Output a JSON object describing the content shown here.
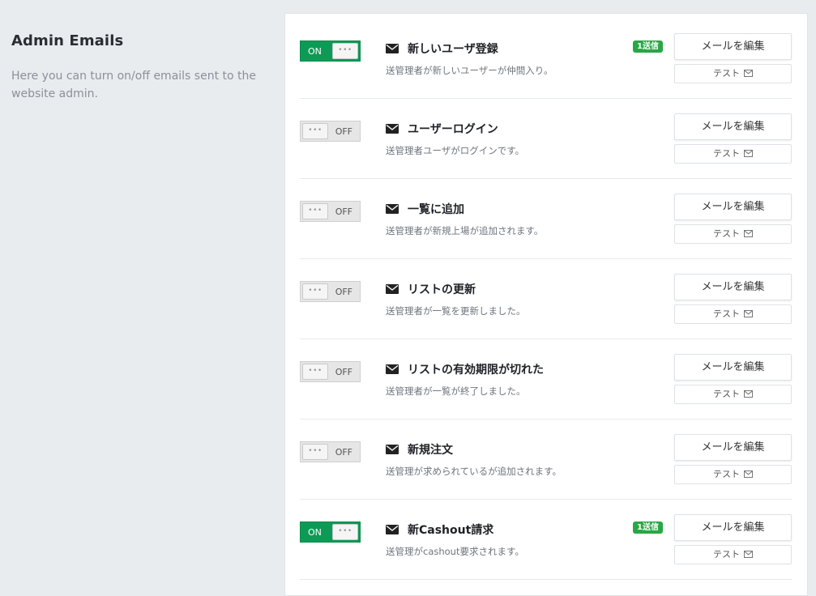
{
  "section": {
    "title": "Admin Emails",
    "description": "Here you can turn on/off emails sent to the website admin."
  },
  "toggle_text": {
    "on": "ON",
    "off": "OFF",
    "grip": "•••"
  },
  "icons": {
    "envelope": "envelope-icon",
    "test_mail": "envelope-outline-icon"
  },
  "colors": {
    "on": "#0d9a55",
    "badge": "#28a745"
  },
  "emails": [
    {
      "enabled": true,
      "title": "新しいユーザ登録",
      "desc": "送管理者が新しいユーザーが仲間入り。",
      "badge": "1送信",
      "edit": "メールを編集",
      "test": "テスト"
    },
    {
      "enabled": false,
      "title": "ユーザーログイン",
      "desc": "送管理者ユーザがログインです。",
      "badge": "",
      "edit": "メールを編集",
      "test": "テスト"
    },
    {
      "enabled": false,
      "title": "一覧に追加",
      "desc": "送管理者が新規上場が追加されます。",
      "badge": "",
      "edit": "メールを編集",
      "test": "テスト"
    },
    {
      "enabled": false,
      "title": "リストの更新",
      "desc": "送管理者が一覧を更新しました。",
      "badge": "",
      "edit": "メールを編集",
      "test": "テスト"
    },
    {
      "enabled": false,
      "title": "リストの有効期限が切れた",
      "desc": "送管理者が一覧が終了しました。",
      "badge": "",
      "edit": "メールを編集",
      "test": "テスト"
    },
    {
      "enabled": false,
      "title": "新規注文",
      "desc": "送管理が求められているが追加されます。",
      "badge": "",
      "edit": "メールを編集",
      "test": "テスト"
    },
    {
      "enabled": true,
      "title": "新Cashout請求",
      "desc": "送管理がcashout要求されます。",
      "badge": "1送信",
      "edit": "メールを編集",
      "test": "テスト"
    }
  ]
}
